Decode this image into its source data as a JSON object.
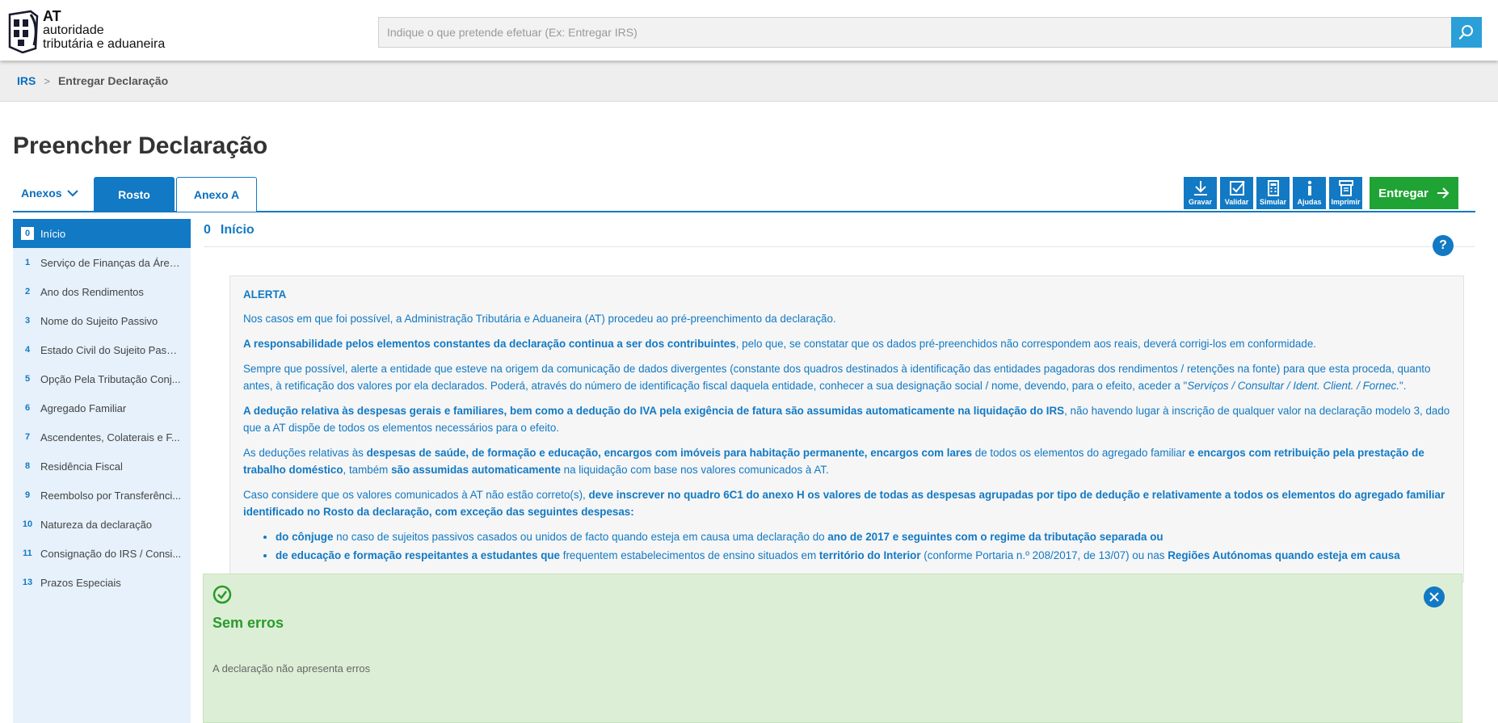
{
  "brand": {
    "short": "AT",
    "line1": "autoridade",
    "line2": "tributária e aduaneira"
  },
  "search": {
    "placeholder": "Indique o que pretende efetuar (Ex: Entregar IRS)",
    "value": "",
    "icon": "search-icon"
  },
  "breadcrumb": {
    "root": "IRS",
    "separator": ">",
    "current": "Entregar Declaração"
  },
  "page_title": "Preencher Declaração",
  "tabs": {
    "anexos": "Anexos",
    "items": [
      "Rosto",
      "Anexo A"
    ],
    "active": "Rosto"
  },
  "toolbar": {
    "tools": [
      {
        "label": "Gravar",
        "icon": "download-icon"
      },
      {
        "label": "Validar",
        "icon": "checkbox-icon"
      },
      {
        "label": "Simular",
        "icon": "calculator-icon"
      },
      {
        "label": "Ajudas",
        "icon": "info-icon"
      },
      {
        "label": "Imprimir",
        "icon": "printer-icon"
      }
    ],
    "submit_label": "Entregar"
  },
  "sidebar": {
    "items": [
      {
        "num": "0",
        "label": "Início"
      },
      {
        "num": "1",
        "label": "Serviço de Finanças da Área..."
      },
      {
        "num": "2",
        "label": "Ano dos Rendimentos"
      },
      {
        "num": "3",
        "label": "Nome do Sujeito Passivo"
      },
      {
        "num": "4",
        "label": "Estado Civil do Sujeito Passi..."
      },
      {
        "num": "5",
        "label": "Opção Pela Tributação Conj..."
      },
      {
        "num": "6",
        "label": "Agregado Familiar"
      },
      {
        "num": "7",
        "label": "Ascendentes, Colaterais e F..."
      },
      {
        "num": "8",
        "label": "Residência Fiscal"
      },
      {
        "num": "9",
        "label": "Reembolso por Transferênci..."
      },
      {
        "num": "10",
        "label": "Natureza da declaração"
      },
      {
        "num": "11",
        "label": "Consignação do IRS / Consi..."
      },
      {
        "num": "13",
        "label": "Prazos Especiais"
      }
    ],
    "active_index": 0
  },
  "section": {
    "num": "0",
    "title": "Início",
    "help": "?"
  },
  "alert": {
    "title": "ALERTA",
    "p1": "Nos casos em que foi possível, a Administração Tributária e Aduaneira (AT) procedeu ao pré-preenchimento da declaração.",
    "p2_bold": "A responsabilidade pelos elementos constantes da declaração continua a ser dos contribuintes",
    "p2_rest": ", pelo que, se constatar que os dados pré-preenchidos não correspondem aos reais, deverá corrigi-los em conformidade.",
    "p3_text": "Sempre que possível, alerte a entidade que esteve na origem da comunicação de dados divergentes (constante dos quadros destinados à identificação das entidades pagadoras dos rendimentos / retenções na fonte) para que esta proceda, quanto antes, à retificação dos valores por ela declarados. Poderá, através do número de identificação fiscal daquela entidade, conhecer a sua designação social / nome, devendo, para o efeito, aceder a \"",
    "p3_italic": "Serviços / Consultar / Ident. Client. / Fornec.",
    "p3_end": "\".",
    "p4_bold": "A dedução relativa às despesas gerais e familiares, bem como a dedução do IVA pela exigência de fatura são assumidas automaticamente na liquidação do IRS",
    "p4_rest": ", não havendo lugar à inscrição de qualquer valor na declaração modelo 3, dado que a AT dispõe de todos os elementos necessários para o efeito.",
    "p5_a": "As deduções relativas às ",
    "p5_b": "despesas de saúde, de formação e educação, encargos com imóveis para habitação permanente, encargos com lares",
    "p5_c": " de todos os elementos do agregado familiar ",
    "p5_d": "e encargos com retribuição pela prestação de trabalho doméstico",
    "p5_e": ", também ",
    "p5_f": "são assumidas automaticamente",
    "p5_g": " na liquidação com base nos valores comunicados à AT.",
    "p6_a": "Caso considere que os valores comunicados à AT não estão correto(s), ",
    "p6_b": "deve inscrever no quadro 6C1 do anexo H os valores de todas as despesas agrupadas por tipo de dedução e relativamente a todos os elementos do agregado familiar identificado no Rosto da declaração, com exceção das seguintes despesas:",
    "li1_a": "do cônjuge",
    "li1_b": " no caso de sujeitos passivos casados ou unidos de facto quando esteja em causa uma declaração do ",
    "li1_c": "ano de 2017 e seguintes com o regime da tributação separada ou",
    "li2_a": "de educação e formação respeitantes a estudantes que",
    "li2_b": " frequentem estabelecimentos de ensino situados em ",
    "li2_c": "território do Interior",
    "li2_d": " (conforme Portaria n.º 208/2017, de 13/07) ou nas ",
    "li2_e": "Regiões Autónomas quando esteja em causa"
  },
  "result": {
    "title": "Sem erros",
    "message": "A declaração não apresenta erros"
  },
  "colors": {
    "primary": "#1279c4",
    "success": "#1fa335",
    "success_bg": "#dcefd6",
    "sidebar_bg": "#e6f1fb"
  }
}
